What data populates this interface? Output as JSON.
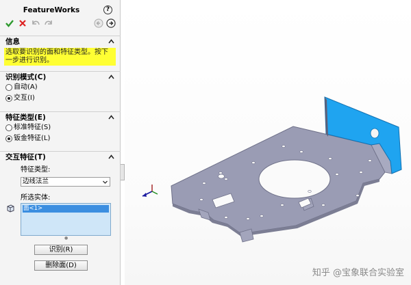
{
  "panel": {
    "title": "FeatureWorks",
    "help": "?",
    "toolbar": [
      "ok-check",
      "cancel-x",
      "undo",
      "redo",
      "back",
      "next"
    ]
  },
  "info": {
    "heading": "信息",
    "message": "选取要识别的面和特征类型。按下一步进行识别。"
  },
  "mode": {
    "heading": "识别模式(C)",
    "options": [
      {
        "label": "自动(A)",
        "selected": false
      },
      {
        "label": "交互(I)",
        "selected": true
      }
    ]
  },
  "feature_type": {
    "heading": "特征类型(E)",
    "options": [
      {
        "label": "标准特征(S)",
        "selected": false
      },
      {
        "label": "钣金特征(L)",
        "selected": true
      }
    ]
  },
  "interactive": {
    "heading": "交互特征(T)",
    "type_label": "特征类型:",
    "type_value": "边线法兰",
    "entities_label": "所选实体:",
    "selected_entity": "面<1>",
    "recognize_button": "识别(R)",
    "delete_face_button": "删除面(D)"
  },
  "watermark": "知乎 @宝象联合实验室",
  "colors": {
    "highlight": "#ffff33",
    "part_gray": "#9a9cb4",
    "selected_face": "#1fa4f0",
    "list_selection": "#3b8ee0"
  }
}
